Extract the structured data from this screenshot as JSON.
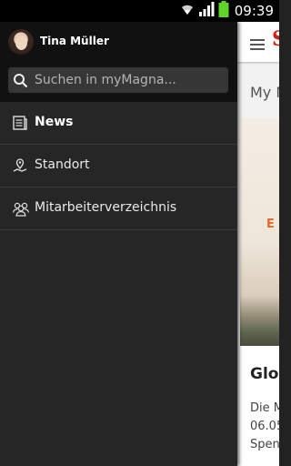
{
  "status_bar": {
    "time": "09:39",
    "icons": [
      "wifi-icon",
      "signal-icon",
      "battery-icon"
    ]
  },
  "drawer": {
    "user": {
      "name": "Tina Müller"
    },
    "search": {
      "placeholder": "Suchen in myMagna..."
    },
    "items": [
      {
        "label": "News",
        "icon": "news-icon",
        "active": true
      },
      {
        "label": "Standort",
        "icon": "location-icon",
        "active": false
      },
      {
        "label": "Mitarbeiterverzeichnis",
        "icon": "employee-directory-icon",
        "active": false
      }
    ]
  },
  "background_app": {
    "logo": "S",
    "section_title": "My M",
    "image_caption": "E",
    "card_title": "Glo",
    "card_text_lines": [
      "Die M",
      "06.05",
      "Spen"
    ]
  },
  "colors": {
    "drawer_bg": "#262626",
    "header_bg": "#111111",
    "brand_red": "#d0201a",
    "battery_green": "#5fd42b"
  }
}
